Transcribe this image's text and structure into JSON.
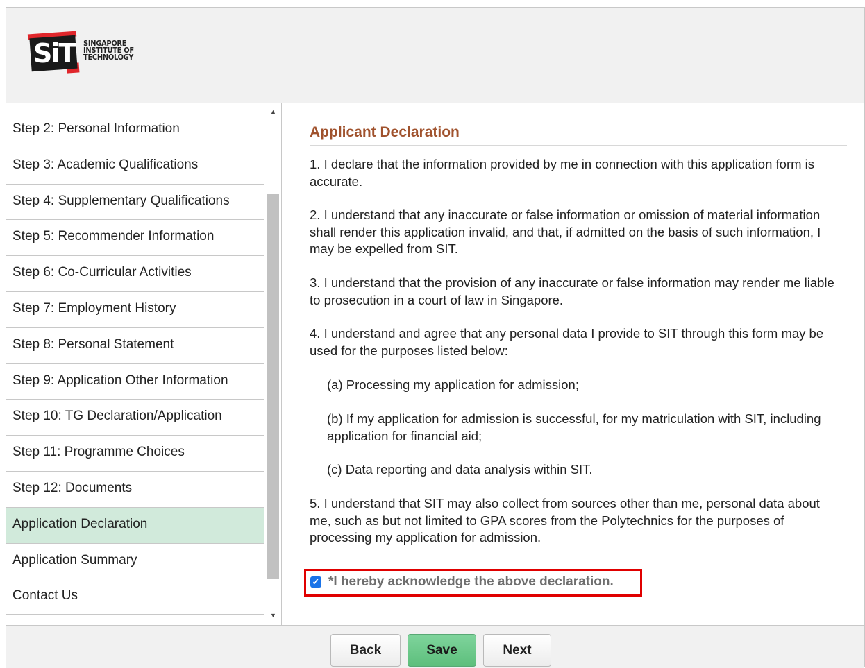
{
  "header": {
    "logo_mark": "SiT",
    "logo_text": [
      "SINGAPORE",
      "INSTITUTE OF",
      "TECHNOLOGY"
    ]
  },
  "sidebar": {
    "items": [
      {
        "label": "Step 2: Personal Information"
      },
      {
        "label": "Step 3: Academic Qualifications"
      },
      {
        "label": "Step 4: Supplementary Qualifications"
      },
      {
        "label": "Step 5: Recommender Information"
      },
      {
        "label": "Step 6: Co-Curricular Activities"
      },
      {
        "label": "Step 7: Employment History"
      },
      {
        "label": "Step 8: Personal Statement"
      },
      {
        "label": "Step 9: Application Other Information"
      },
      {
        "label": "Step 10: TG Declaration/Application"
      },
      {
        "label": "Step 11: Programme Choices"
      },
      {
        "label": "Step 12: Documents"
      },
      {
        "label": "Application Declaration",
        "active": true
      },
      {
        "label": "Application Summary"
      },
      {
        "label": "Contact Us"
      }
    ],
    "accent": "#d1eadb"
  },
  "main": {
    "title": "Applicant Declaration",
    "paragraphs": [
      "1. I declare that the information provided by me in connection with this application form is accurate.",
      "2. I understand that any inaccurate or false information or omission of material information shall render this application invalid, and that, if admitted on the basis of such information, I may be expelled from SIT.",
      "3. I understand that the provision of any inaccurate or false information may render me liable to prosecution in a court of law in Singapore.",
      "4. I understand and agree that any personal data I provide to SIT through this form may be used for the purposes listed below:",
      "(a) Processing my application for admission;",
      "(b) If my application for admission is successful, for my matriculation with SIT, including application for financial aid;",
      "(c) Data reporting and data analysis within SIT.",
      "5. I understand that SIT may also collect from sources other than me, personal data about me, such as but not limited to GPA scores from the Polytechnics for the purposes of processing my application for admission."
    ],
    "acknowledge_label": "*I hereby acknowledge the above declaration.",
    "acknowledge_checked": true
  },
  "footer": {
    "back_label": "Back",
    "save_label": "Save",
    "next_label": "Next"
  },
  "colors": {
    "title": "#a0522d",
    "highlight_border": "#e00000",
    "save_button": "#6cc98a"
  }
}
